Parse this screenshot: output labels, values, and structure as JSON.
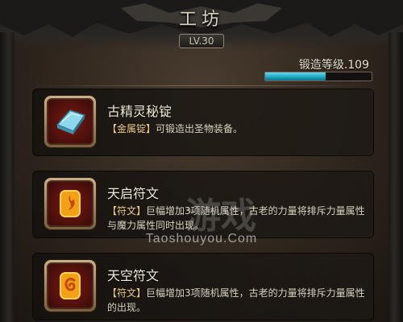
{
  "header": {
    "title": "工坊",
    "level_badge": "LV.30"
  },
  "forge": {
    "label": "锻造等级.109",
    "progress": 0.57
  },
  "items": [
    {
      "name": "古精灵秘锭",
      "tag": "【金属锭】",
      "desc": "可锻造出圣物装备。",
      "icon": "blue-ingot-icon"
    },
    {
      "name": "天启符文",
      "tag": "【符文】",
      "desc": "巨幅增加3项随机属性，古老的力量将排斥力量属性与魔力属性同时出现。",
      "icon": "flame-rune-icon"
    },
    {
      "name": "天空符文",
      "tag": "【符文】",
      "desc": "巨幅增加3项随机属性，古老的力量将排斥力量属性的出现。",
      "icon": "swirl-rune-icon"
    }
  ],
  "watermark": {
    "text": "Taoshouyou.Com",
    "big": "游戏"
  },
  "colors": {
    "progress_fill": "#1aa3bf",
    "tag": "#e9c98a",
    "icon_bg": "#7a1a14"
  }
}
